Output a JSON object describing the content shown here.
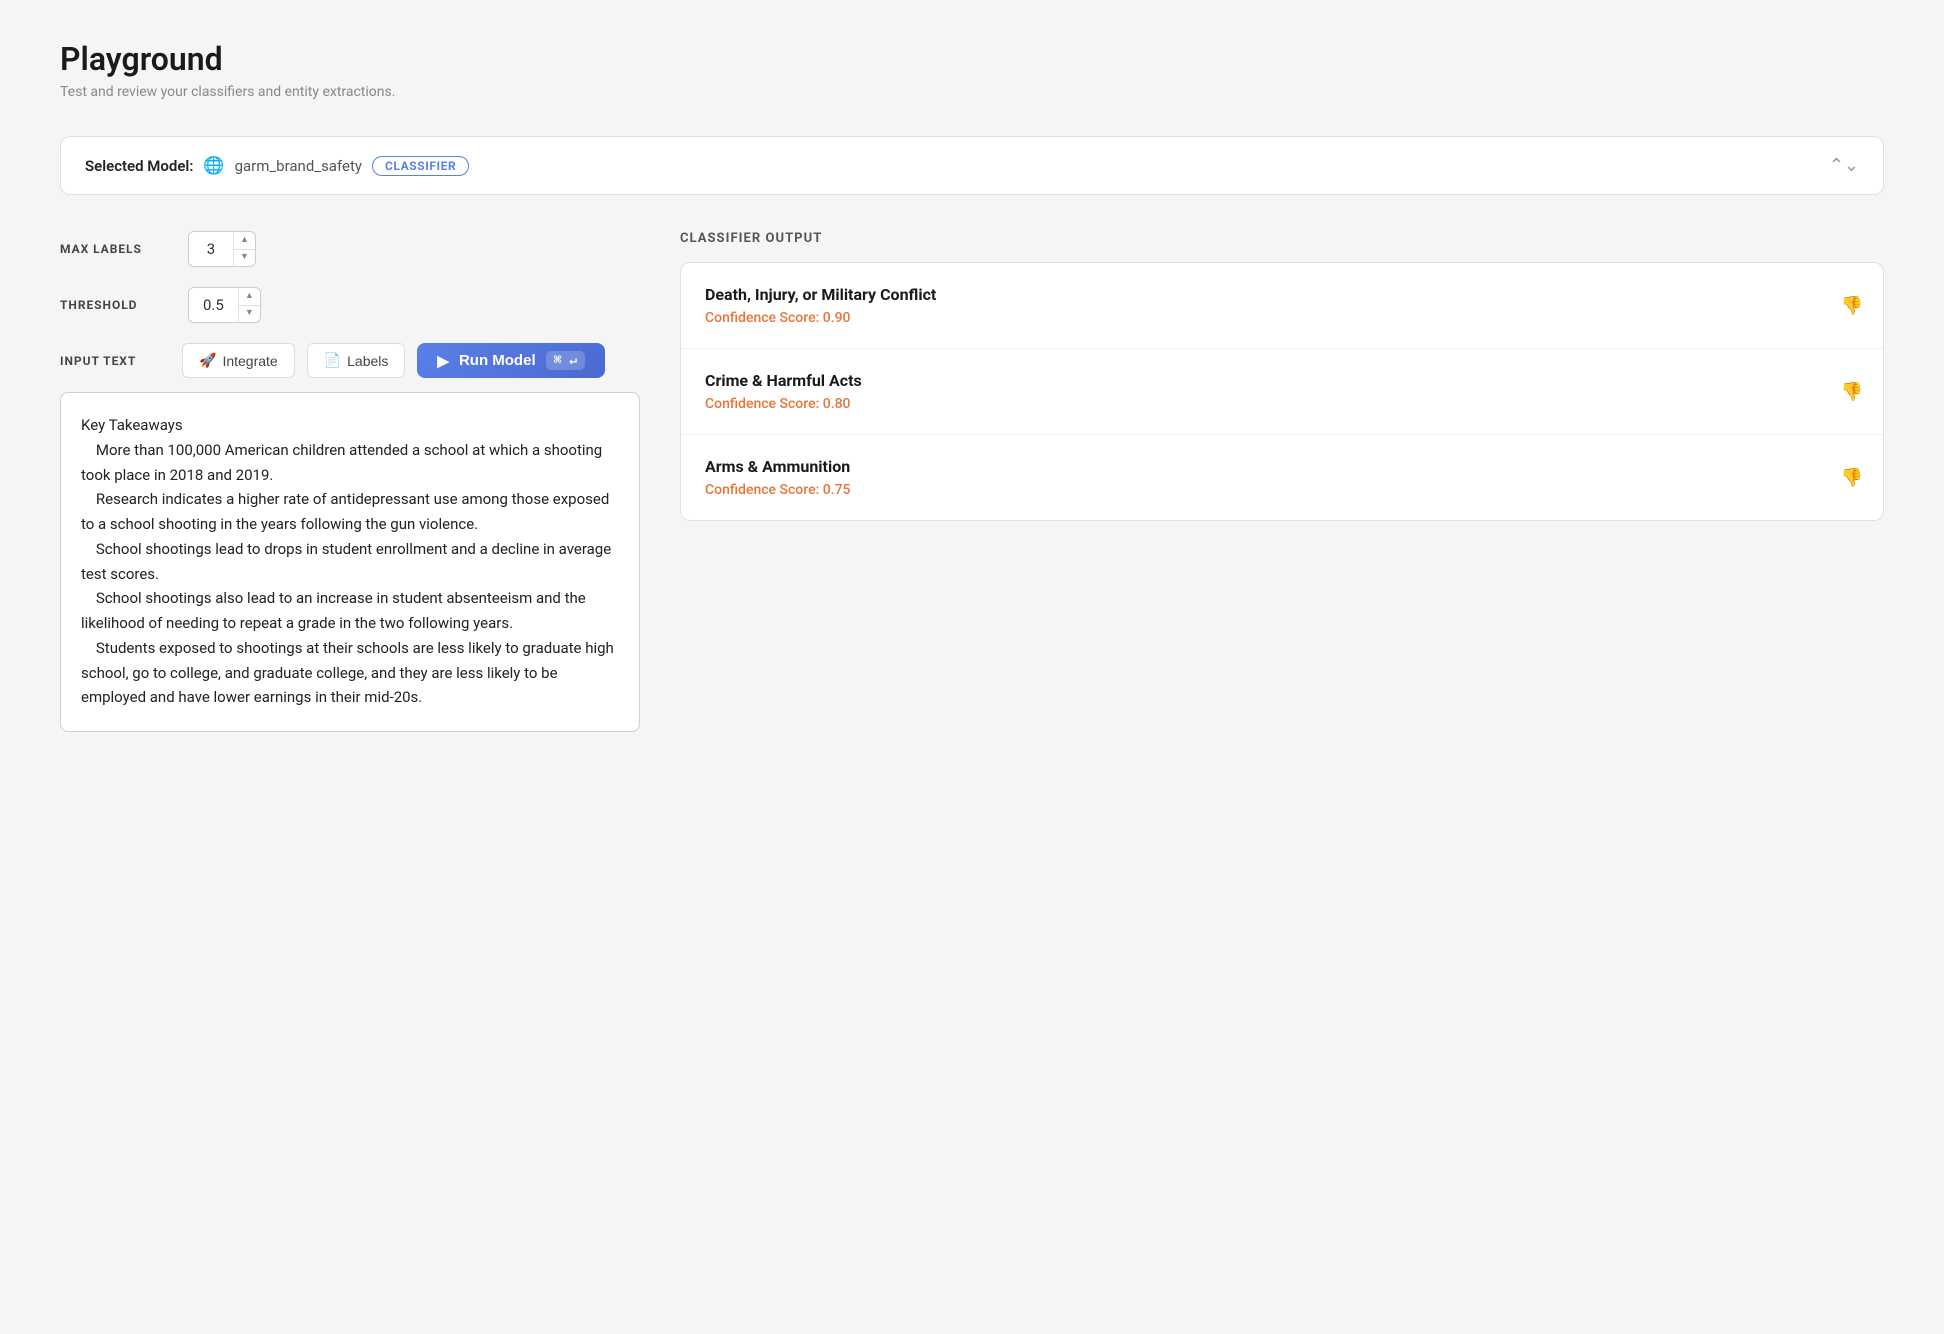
{
  "page": {
    "title": "Playground",
    "subtitle": "Test and review your classifiers and entity extractions."
  },
  "model_selector": {
    "label": "Selected Model:",
    "model_name": "garm_brand_safety",
    "badge": "CLASSIFIER",
    "chevron": "⌃⌄"
  },
  "controls": {
    "max_labels_label": "MAX LABELS",
    "max_labels_value": "3",
    "threshold_label": "THRESHOLD",
    "threshold_value": "0.5",
    "input_text_label": "INPUT TEXT",
    "integrate_btn": "Integrate",
    "labels_btn": "Labels",
    "run_btn": "Run Model",
    "run_shortcut": "⌘ ↵"
  },
  "input_text": "Key Takeaways\n    More than 100,000 American children attended a school at which a shooting took place in 2018 and 2019.\n    Research indicates a higher rate of antidepressant use among those exposed to a school shooting in the years following the gun violence.\n    School shootings lead to drops in student enrollment and a decline in average test scores.\n    School shootings also lead to an increase in student absenteeism and the likelihood of needing to repeat a grade in the two following years.\n    Students exposed to shootings at their schools are less likely to graduate high school, go to college, and graduate college, and they are less likely to be employed and have lower earnings in their mid-20s.",
  "output": {
    "section_label": "CLASSIFIER OUTPUT",
    "items": [
      {
        "title": "Death, Injury, or Military Conflict",
        "score_label": "Confidence Score: 0.90"
      },
      {
        "title": "Crime & Harmful Acts",
        "score_label": "Confidence Score: 0.80"
      },
      {
        "title": "Arms & Ammunition",
        "score_label": "Confidence Score: 0.75"
      }
    ]
  },
  "icons": {
    "globe": "🌐",
    "integrate": "🚀",
    "labels": "📄",
    "run_play": "▶",
    "thumbs_down": "👎",
    "arrow_up": "▲",
    "arrow_down": "▼"
  }
}
